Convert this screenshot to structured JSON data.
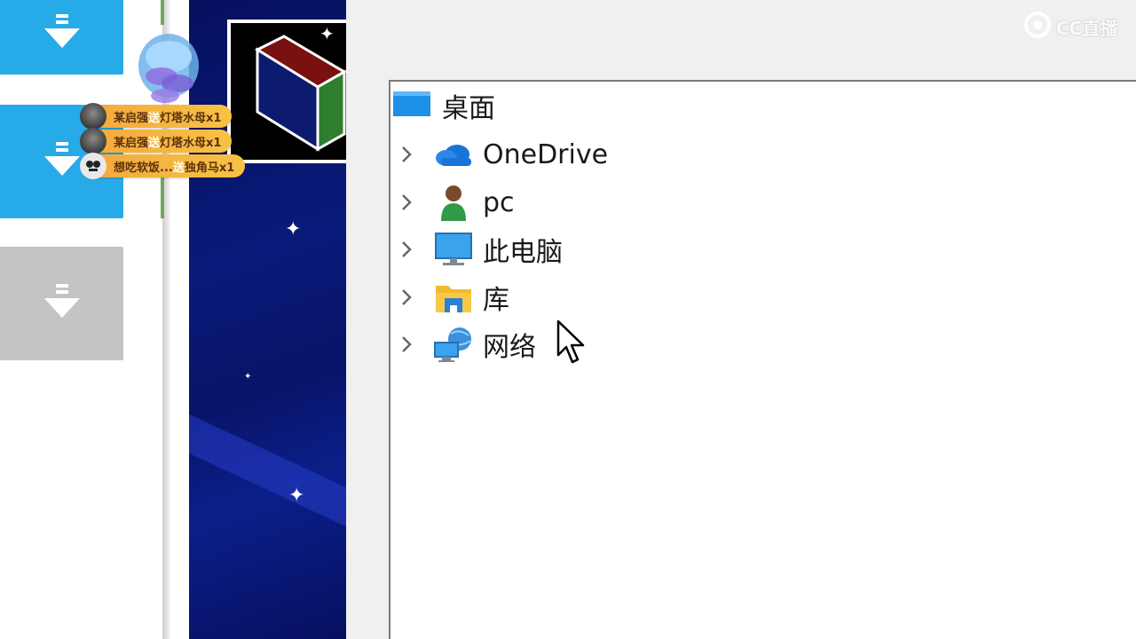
{
  "gifts": [
    {
      "user": "某启强",
      "verb": "送",
      "item": "灯塔水母x1"
    },
    {
      "user": "某启强",
      "verb": "送",
      "item": "灯塔水母x1"
    },
    {
      "user": "想吃软饭...",
      "verb": "送",
      "item": "独角马x1"
    }
  ],
  "tree": {
    "root": {
      "label": "桌面",
      "icon": "desktop-icon"
    },
    "items": [
      {
        "label": "OneDrive",
        "icon": "onedrive-icon"
      },
      {
        "label": "pc",
        "icon": "user-icon",
        "selected": true
      },
      {
        "label": "此电脑",
        "icon": "this-pc-icon"
      },
      {
        "label": "库",
        "icon": "library-icon"
      },
      {
        "label": "网络",
        "icon": "network-icon"
      }
    ]
  },
  "watermark": {
    "text": "CC直播",
    "icon": "cc-logo-icon"
  },
  "download_tiles": [
    {
      "state": "active",
      "icon": "download-icon"
    },
    {
      "state": "active",
      "icon": "download-icon"
    },
    {
      "state": "disabled",
      "icon": "download-icon"
    }
  ]
}
